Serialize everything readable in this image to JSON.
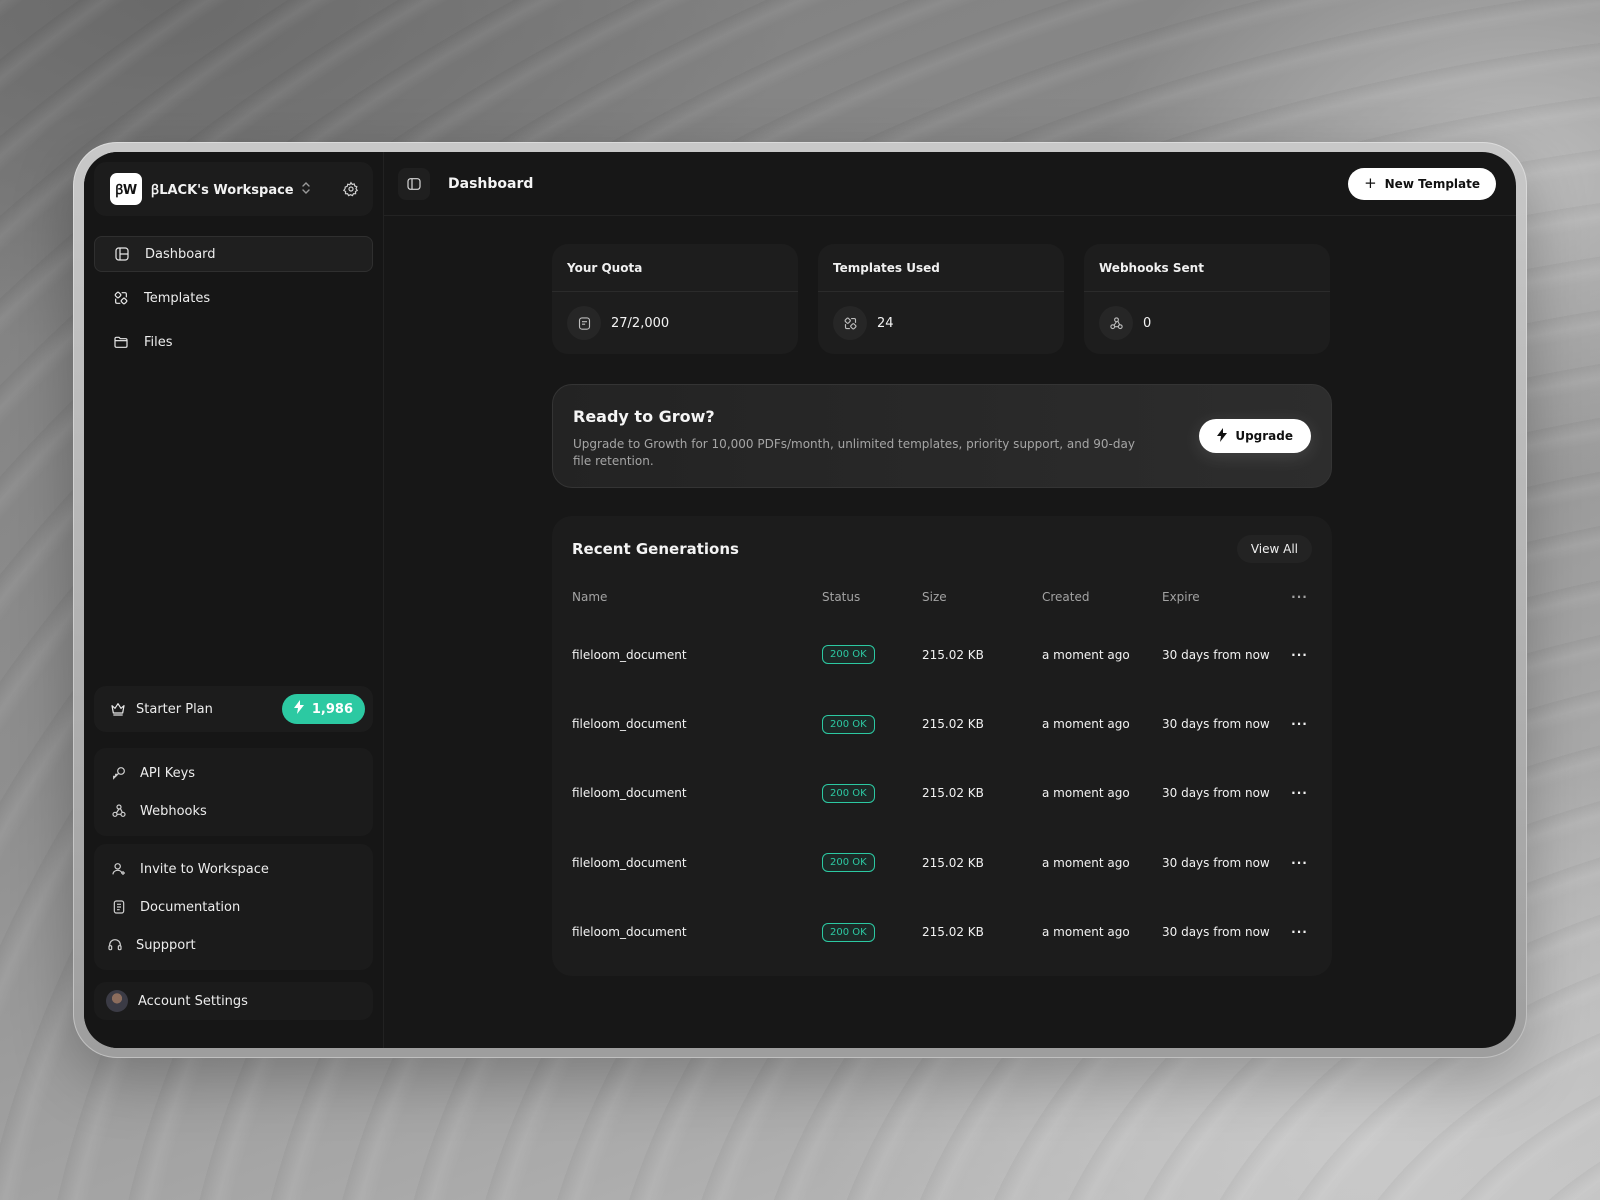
{
  "workspace": {
    "logo_text": "ꞵW",
    "name": "ꞵLACK's Workspace"
  },
  "sidebar": {
    "nav": [
      {
        "label": "Dashboard",
        "icon": "layout-icon",
        "active": true
      },
      {
        "label": "Templates",
        "icon": "templates-icon",
        "active": false
      },
      {
        "label": "Files",
        "icon": "folder-icon",
        "active": false
      }
    ],
    "plan": {
      "label": "Starter Plan",
      "credits": "1,986"
    },
    "dev_links": [
      {
        "label": "API Keys",
        "icon": "key-icon"
      },
      {
        "label": "Webhooks",
        "icon": "webhook-icon"
      }
    ],
    "help_links": [
      {
        "label": "Invite to Workspace",
        "icon": "user-plus-icon"
      },
      {
        "label": "Documentation",
        "icon": "document-icon"
      },
      {
        "label": "Suppport",
        "icon": "headset-icon"
      }
    ],
    "account": {
      "label": "Account Settings"
    }
  },
  "header": {
    "title": "Dashboard",
    "new_button": "New Template"
  },
  "stats": [
    {
      "title": "Your Quota",
      "value": "27/2,000",
      "icon": "quota-icon"
    },
    {
      "title": "Templates Used",
      "value": "24",
      "icon": "templates-icon"
    },
    {
      "title": "Webhooks Sent",
      "value": "0",
      "icon": "webhook-icon"
    }
  ],
  "promo": {
    "title": "Ready to Grow?",
    "description": "Upgrade to Growth for 10,000 PDFs/month, unlimited templates, priority support, and 90-day file retention.",
    "button": "Upgrade"
  },
  "recent": {
    "title": "Recent Generations",
    "view_all": "View All",
    "columns": [
      "Name",
      "Status",
      "Size",
      "Created",
      "Expire"
    ],
    "more": "···",
    "rows": [
      {
        "name": "fileloom_document",
        "status": "200 OK",
        "size": "215.02 KB",
        "created": "a moment ago",
        "expire": "30 days from now"
      },
      {
        "name": "fileloom_document",
        "status": "200 OK",
        "size": "215.02 KB",
        "created": "a moment ago",
        "expire": "30 days from now"
      },
      {
        "name": "fileloom_document",
        "status": "200 OK",
        "size": "215.02 KB",
        "created": "a moment ago",
        "expire": "30 days from now"
      },
      {
        "name": "fileloom_document",
        "status": "200 OK",
        "size": "215.02 KB",
        "created": "a moment ago",
        "expire": "30 days from now"
      },
      {
        "name": "fileloom_document",
        "status": "200 OK",
        "size": "215.02 KB",
        "created": "a moment ago",
        "expire": "30 days from now"
      }
    ]
  },
  "colors": {
    "accent": "#2cc9a2",
    "background": "#171717",
    "card": "#1d1d1d"
  }
}
